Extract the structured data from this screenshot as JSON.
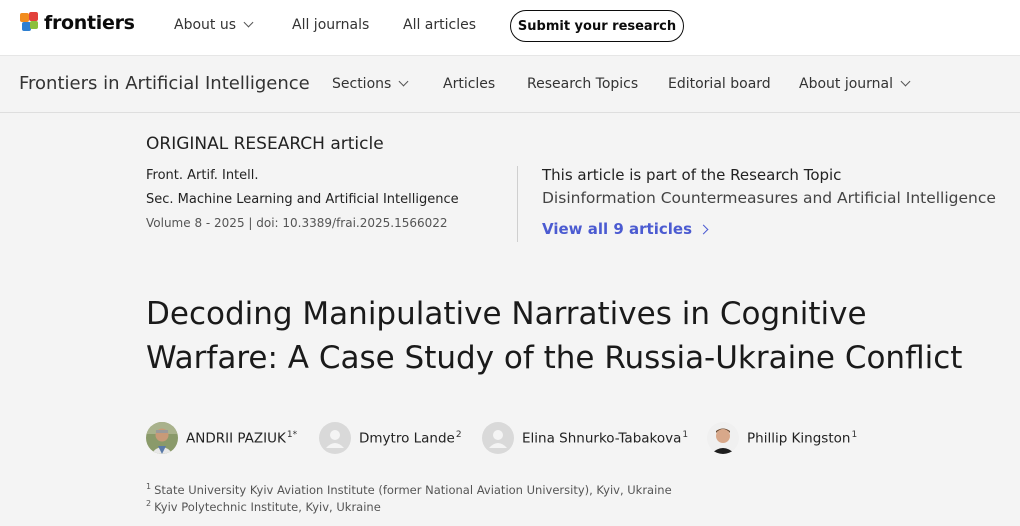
{
  "topnav": {
    "brand": "frontiers",
    "items": [
      {
        "label": "About us",
        "dropdown": true
      },
      {
        "label": "All journals",
        "dropdown": false
      },
      {
        "label": "All articles",
        "dropdown": false
      }
    ],
    "submit_label": "Submit your research"
  },
  "journalnav": {
    "title": "Frontiers in Artificial Intelligence",
    "items": [
      {
        "label": "Sections",
        "dropdown": true
      },
      {
        "label": "Articles",
        "dropdown": false
      },
      {
        "label": "Research Topics",
        "dropdown": false
      },
      {
        "label": "Editorial board",
        "dropdown": false
      },
      {
        "label": "About journal",
        "dropdown": true
      }
    ]
  },
  "article": {
    "type": "ORIGINAL RESEARCH article",
    "journal_abbr": "Front. Artif. Intell.",
    "section": "Sec. Machine Learning and Artificial Intelligence",
    "volume_doi": "Volume 8 - 2025 | doi: 10.3389/frai.2025.1566022",
    "research_topic_label": "This article is part of the Research Topic",
    "research_topic_name": "Disinformation Countermeasures and Artificial Intelligence",
    "view_all_label": "View all 9 articles",
    "title": "Decoding Manipulative Narratives in Cognitive Warfare: A Case Study of the Russia-Ukraine Conflict"
  },
  "authors": [
    {
      "name": "ANDRII PAZIUK",
      "sup": "1*",
      "avatar": "photo"
    },
    {
      "name": "Dmytro Lande",
      "sup": "2",
      "avatar": "placeholder"
    },
    {
      "name": "Elina Shnurko-Tabakova",
      "sup": "1",
      "avatar": "placeholder"
    },
    {
      "name": "Phillip Kingston",
      "sup": "1",
      "avatar": "photo"
    }
  ],
  "affiliations": [
    {
      "num": "1",
      "text": "State University Kyiv Aviation Institute (former National Aviation University), Kyiv, Ukraine"
    },
    {
      "num": "2",
      "text": "Kyiv Polytechnic Institute, Kyiv, Ukraine"
    }
  ],
  "colors": {
    "accent_link": "#4b5bd1",
    "logo_orange": "#f28c1e",
    "logo_red": "#e2403a",
    "logo_blue": "#2e7fd1",
    "logo_green": "#8bbf3c"
  }
}
